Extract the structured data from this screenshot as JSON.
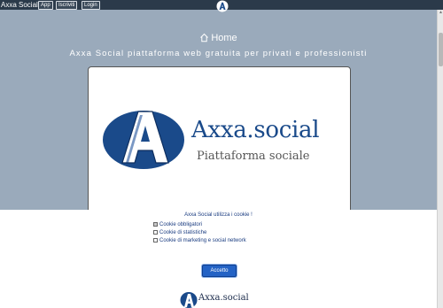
{
  "topbar": {
    "brand": "Axxa Social",
    "buttons": [
      "App",
      "Iscriviti",
      "Login"
    ],
    "logo_icon": "axxa-a-logo-icon"
  },
  "hero": {
    "home_icon": "home-icon",
    "home_label": "Home",
    "tagline": "Axxa Social piattaforma web gratuita per privati e professionisti",
    "logo_title": "Axxa.social",
    "logo_subtitle": "Piattaforma sociale"
  },
  "cookie": {
    "title": "Axxa Social utilizza i cookie !",
    "options": [
      {
        "label": "Cookie obbligatori",
        "checked": true
      },
      {
        "label": "Cookie di statistiche",
        "checked": false
      },
      {
        "label": "Cookie di marketing e social network",
        "checked": false
      }
    ],
    "accept_label": "Accetto",
    "footer_logo_text": "Axxa.social"
  },
  "colors": {
    "background": "#9aaabb",
    "topbar": "#2b3a4a",
    "brand_blue": "#1a4a8a",
    "accept_button": "#2463c5"
  }
}
